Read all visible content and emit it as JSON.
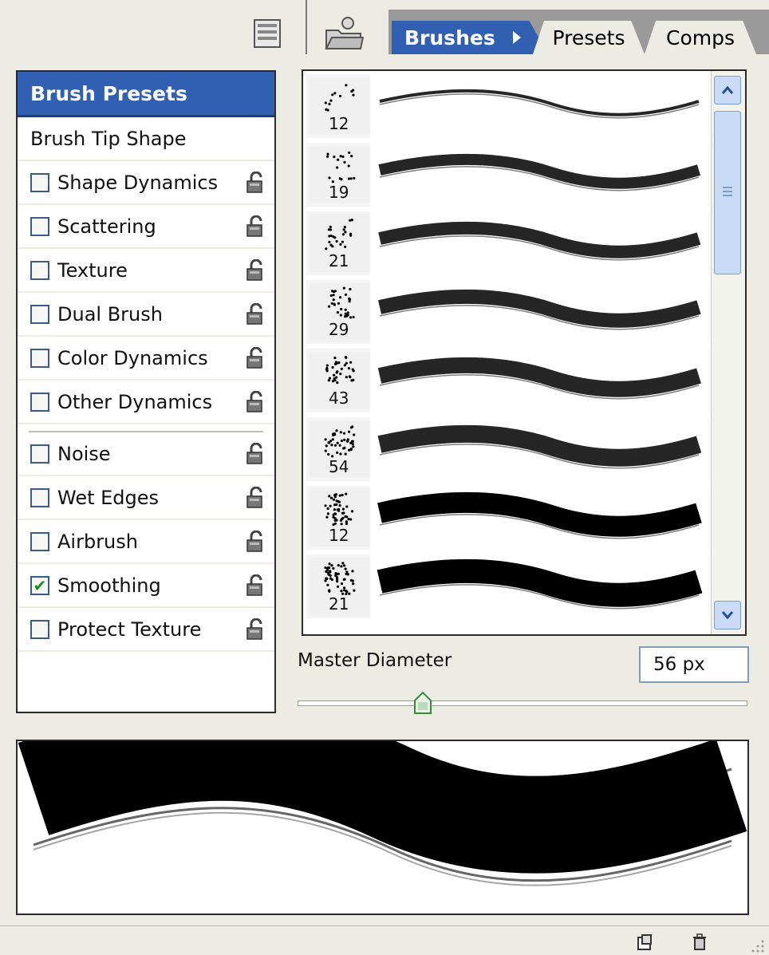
{
  "tabs": {
    "brushes": "Brushes",
    "presets": "Presets",
    "comps": "Comps"
  },
  "toolbar": {
    "palette_icon": "palette-well-icon",
    "folder_icon": "tool-presets-folder-icon"
  },
  "options": {
    "header": "Brush Presets",
    "tip_shape": "Brush Tip Shape",
    "items": [
      {
        "label": "Shape Dynamics",
        "checked": false
      },
      {
        "label": "Scattering",
        "checked": false
      },
      {
        "label": "Texture",
        "checked": false
      },
      {
        "label": "Dual Brush",
        "checked": false
      },
      {
        "label": "Color Dynamics",
        "checked": false
      },
      {
        "label": "Other Dynamics",
        "checked": false
      },
      {
        "label": "Noise",
        "checked": false
      },
      {
        "label": "Wet Edges",
        "checked": false
      },
      {
        "label": "Airbrush",
        "checked": false
      },
      {
        "label": "Smoothing",
        "checked": true
      },
      {
        "label": "Protect Texture",
        "checked": false
      }
    ],
    "check_mark": "✔"
  },
  "brushes": [
    {
      "size": "12"
    },
    {
      "size": "19"
    },
    {
      "size": "21"
    },
    {
      "size": "29"
    },
    {
      "size": "43"
    },
    {
      "size": "54"
    },
    {
      "size": "12"
    },
    {
      "size": "21"
    }
  ],
  "master_diameter": {
    "label": "Master Diameter",
    "value": "56 px",
    "slider_fraction": 0.28
  },
  "colors": {
    "accent": "#3160b2",
    "panel_bg": "#ecebe4"
  }
}
